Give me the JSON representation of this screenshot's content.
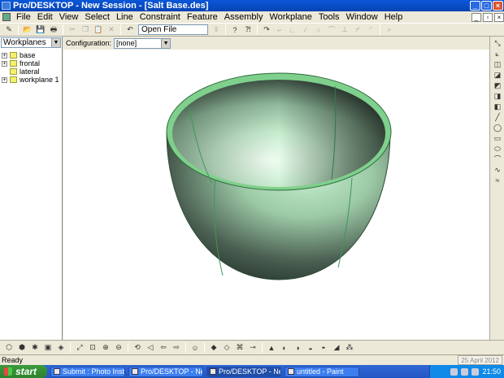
{
  "window": {
    "title": "Pro/DESKTOP - New Session - [Salt Base.des]",
    "buttons": {
      "minimize": "_",
      "maximize": "□",
      "close": "×"
    }
  },
  "menu": [
    "File",
    "Edit",
    "View",
    "Select",
    "Line",
    "Constraint",
    "Feature",
    "Assembly",
    "Workplane",
    "Tools",
    "Window",
    "Help"
  ],
  "toolbar": {
    "open_file_label": "Open File",
    "icons": [
      "pencil-icon",
      "open-folder-icon",
      "save-icon",
      "print-icon",
      "cut-icon",
      "copy-icon",
      "paste-icon",
      "delete-icon",
      "undo-icon",
      "help-icon",
      "context-help-icon",
      "redo-icon",
      "line-icon",
      "angle-icon",
      "slash-icon",
      "circle-icon",
      "arc-icon",
      "constraint-icon",
      "trim-icon",
      "fillet-icon",
      "measure-icon"
    ]
  },
  "left_panel": {
    "browser_select": "Workplanes",
    "tree": [
      {
        "label": "base",
        "expandable": true
      },
      {
        "label": "frontal",
        "expandable": true
      },
      {
        "label": "lateral",
        "expandable": false
      },
      {
        "label": "workplane 1",
        "expandable": true
      }
    ]
  },
  "config": {
    "label": "Configuration:",
    "value": "[none]"
  },
  "viewport": {
    "model": "bowl",
    "colors": {
      "rim": "#7fd08c",
      "body_light": "#c8efd0",
      "body_dark": "#1d2a22",
      "edge": "#3a9a55"
    }
  },
  "status": {
    "text": "Ready",
    "date": "25 April 2012"
  },
  "taskbar": {
    "start_label": "start",
    "tasks": [
      {
        "label": "Submit : Photo Instru...",
        "active": false
      },
      {
        "label": "Pro/DESKTOP - New ...",
        "active": false
      },
      {
        "label": "Pro/DESKTOP - New ...",
        "active": true
      },
      {
        "label": "untitled - Paint",
        "active": false
      }
    ],
    "clock": "21:50"
  }
}
